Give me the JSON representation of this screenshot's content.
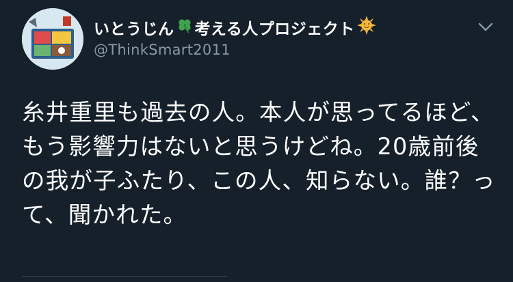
{
  "header": {
    "display_name_part1": "いとうじん",
    "display_name_part2": "考える人プロジェクト",
    "emoji_1": "clover-icon",
    "emoji_2": "sun-face-icon",
    "handle": "@ThinkSmart2011"
  },
  "tweet": {
    "text": "糸井重里も過去の人。本人が思ってるほど、もう影響力はないと思うけどね。20歳前後の我が子ふたり、この人、知らない。誰？って、聞かれた。"
  },
  "colors": {
    "background": "#15202b",
    "text_primary": "#ffffff",
    "text_secondary": "#8899a6",
    "clover": "#3fa34d",
    "sun": "#f6b93b"
  }
}
